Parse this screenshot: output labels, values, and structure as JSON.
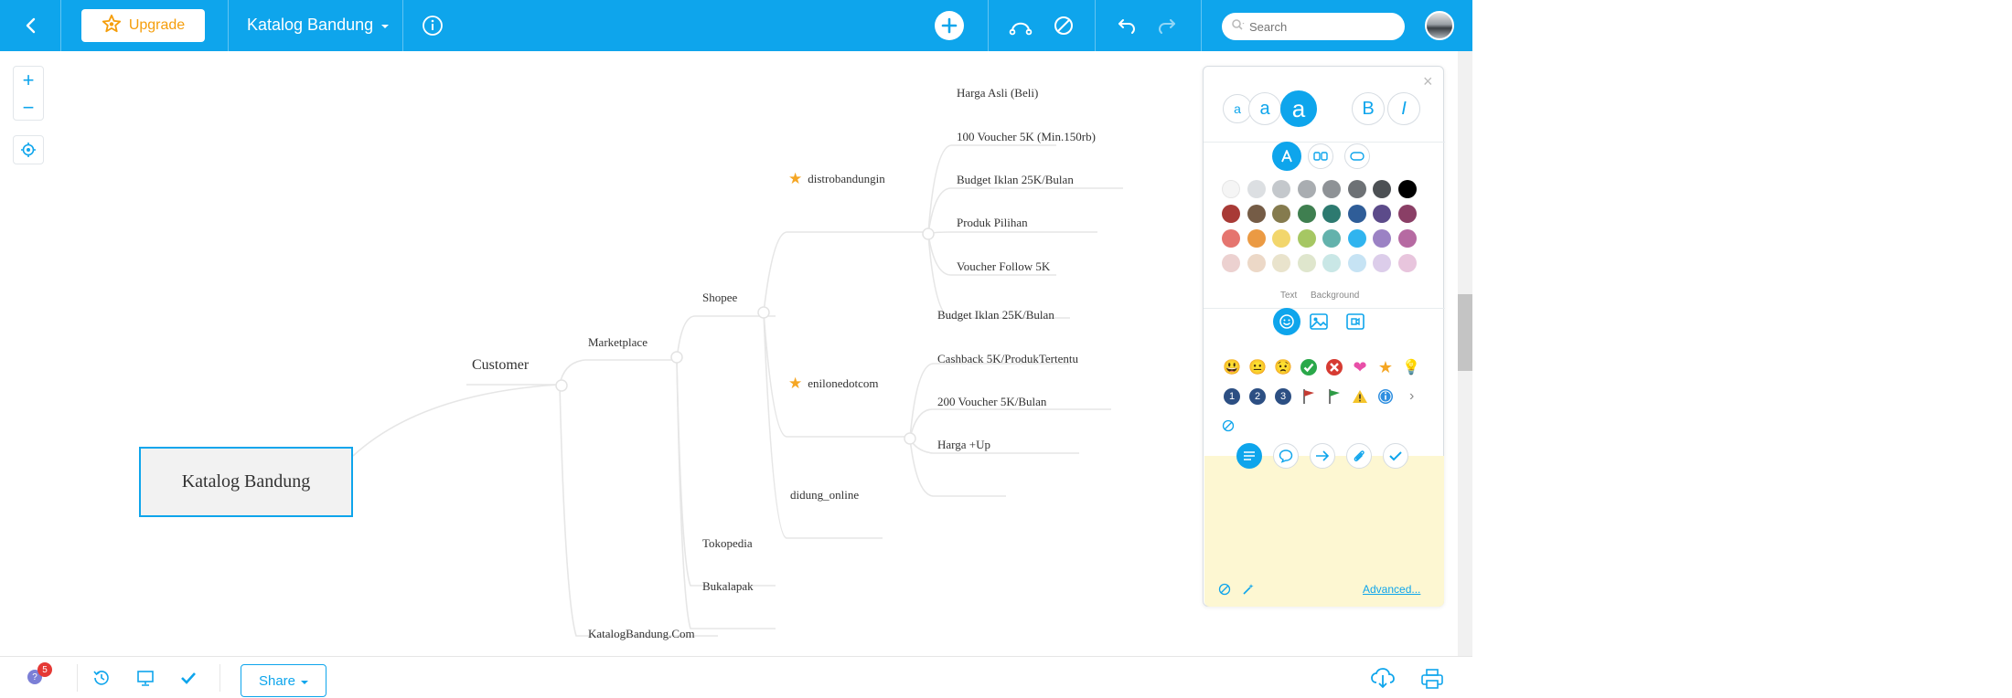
{
  "topbar": {
    "upgrade_label": "Upgrade",
    "doc_title": "Katalog Bandung",
    "search_placeholder": "Search"
  },
  "map": {
    "root": "Katalog Bandung",
    "customer": "Customer",
    "marketplace": "Marketplace",
    "shopee": "Shopee",
    "distrobandungin": "distrobandungin",
    "distro_children": [
      "Harga Asli (Beli)",
      "100 Voucher 5K (Min.150rb)",
      "Budget Iklan 25K/Bulan",
      "Produk Pilihan",
      "Voucher Follow 5K"
    ],
    "enilonedotcom": "enilonedotcom",
    "enilone_children": [
      "Budget Iklan 25K/Bulan",
      "Cashback 5K/ProdukTertentu",
      "200 Voucher 5K/Bulan",
      "Harga +Up"
    ],
    "didung_online": "didung_online",
    "tokopedia": "Tokopedia",
    "bukalapak": "Bukalapak",
    "katalogbandung_com": "KatalogBandung.Com"
  },
  "panel": {
    "font_sizes": [
      "a",
      "a",
      "a"
    ],
    "bold_label": "B",
    "italic_label": "I",
    "text_tab": "Text",
    "background_tab": "Background",
    "advanced_link": "Advanced...",
    "colors_row1": [
      "#f5f5f5",
      "#dcdfe2",
      "#c4c8cc",
      "#a9adb1",
      "#8e9296",
      "#6d7175",
      "#4c5054",
      "#000000"
    ],
    "colors_row2": [
      "#a83a36",
      "#755c46",
      "#857b4e",
      "#3f7f50",
      "#2d7a70",
      "#2f5d98",
      "#5c4b8a",
      "#8a3f66"
    ],
    "colors_row3": [
      "#e5756f",
      "#eb9a43",
      "#f2d66c",
      "#a6c763",
      "#63b2ac",
      "#30b4ef",
      "#9b82c4",
      "#b66aa2"
    ],
    "colors_row4": [
      "#ecd1d0",
      "#ecd8c7",
      "#e9e3cc",
      "#dfe6cd",
      "#c9e7e6",
      "#c6e3f4",
      "#dccdea",
      "#e8c5dd"
    ],
    "numbers": [
      "1",
      "2",
      "3"
    ]
  },
  "bottom": {
    "share_label": "Share",
    "help_badge": "5"
  }
}
